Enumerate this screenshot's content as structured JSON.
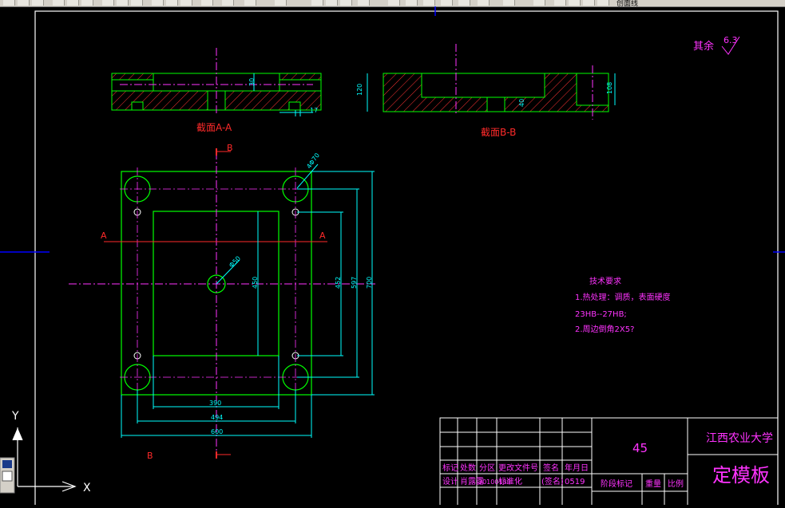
{
  "toolbar": {
    "layer_name": "创面线"
  },
  "drawing": {
    "section_aa_label": "截面A-A",
    "section_bb_label": "截面B-B",
    "marker_b": "B",
    "marker_a": "A",
    "surface_finish": {
      "text": "其余",
      "value": "6.3"
    },
    "dims": {
      "aa_depth": "30",
      "aa_small": "17",
      "bb_left": "120",
      "bb_right": "108",
      "bb_slot": "40",
      "hole_dia": "4Φ70",
      "center_dia": "Φ50",
      "inner_h": "450",
      "mid_h": "452",
      "outer_v": "597",
      "total_h": "700",
      "w_inner": "390",
      "w_mid": "494",
      "w_total": "600"
    },
    "tech_requirements": {
      "title": "技术要求",
      "line1": "1.热处理：调质，表面硬度",
      "line2": "23HB--27HB;",
      "line3": "2.周边倒角2X5?"
    },
    "title_block": {
      "material": "45",
      "school": "江西农业大学",
      "part_name": "定模板",
      "headers": [
        "标记",
        "处数",
        "分区",
        "更改文件号",
        "签名",
        "年月日"
      ],
      "row2": [
        "设计",
        "肖露露",
        "20100139",
        "标准化",
        "(签名)",
        "0519"
      ],
      "stage_label": "阶段标记",
      "weight_label": "重量",
      "scale_label": "比例"
    },
    "ucs": {
      "y_label": "Y",
      "x_label": "X"
    }
  }
}
